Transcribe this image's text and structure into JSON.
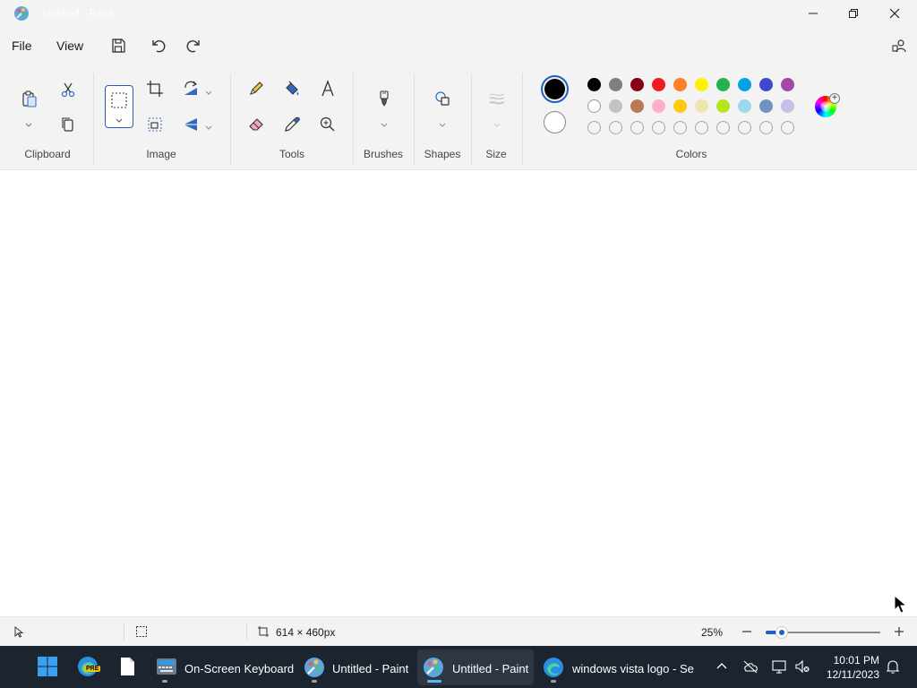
{
  "window": {
    "title": "Untitled - Paint",
    "controls": [
      "minimize-icon",
      "maximize-icon",
      "close-icon"
    ]
  },
  "menu": {
    "file_label": "File",
    "view_label": "View",
    "quick_access": [
      "save-icon",
      "undo-icon",
      "redo-icon"
    ],
    "account_icon": "account-icon"
  },
  "ribbon": {
    "groups": {
      "clipboard": "Clipboard",
      "image": "Image",
      "tools": "Tools",
      "brushes": "Brushes",
      "shapes": "Shapes",
      "size": "Size",
      "colors": "Colors"
    },
    "colors": {
      "primary": "#000000",
      "secondary": "#ffffff",
      "palette_row1": [
        "#000000",
        "#7f7f7f",
        "#880015",
        "#ed1c24",
        "#ff7f27",
        "#fff200",
        "#22b14c",
        "#00a2e8",
        "#3f48cc",
        "#a349a4"
      ],
      "palette_row2": [
        "#ffffff",
        "#c3c3c3",
        "#b97a57",
        "#ffaec9",
        "#ffc90e",
        "#efe4b0",
        "#b5e61d",
        "#99d9ea",
        "#7092be",
        "#c8bfe7"
      ],
      "palette_row3_empty_count": 10
    }
  },
  "status": {
    "canvas_size": "614 × 460px",
    "zoom": "25%"
  },
  "taskbar": {
    "apps": [
      {
        "label": "On-Screen Keyboard"
      },
      {
        "label": "Untitled - Paint"
      },
      {
        "label": "Untitled - Paint"
      },
      {
        "label": "windows vista logo - Se"
      }
    ],
    "edge_badge": "PRE",
    "time": "10:01 PM",
    "date": "12/11/2023"
  }
}
